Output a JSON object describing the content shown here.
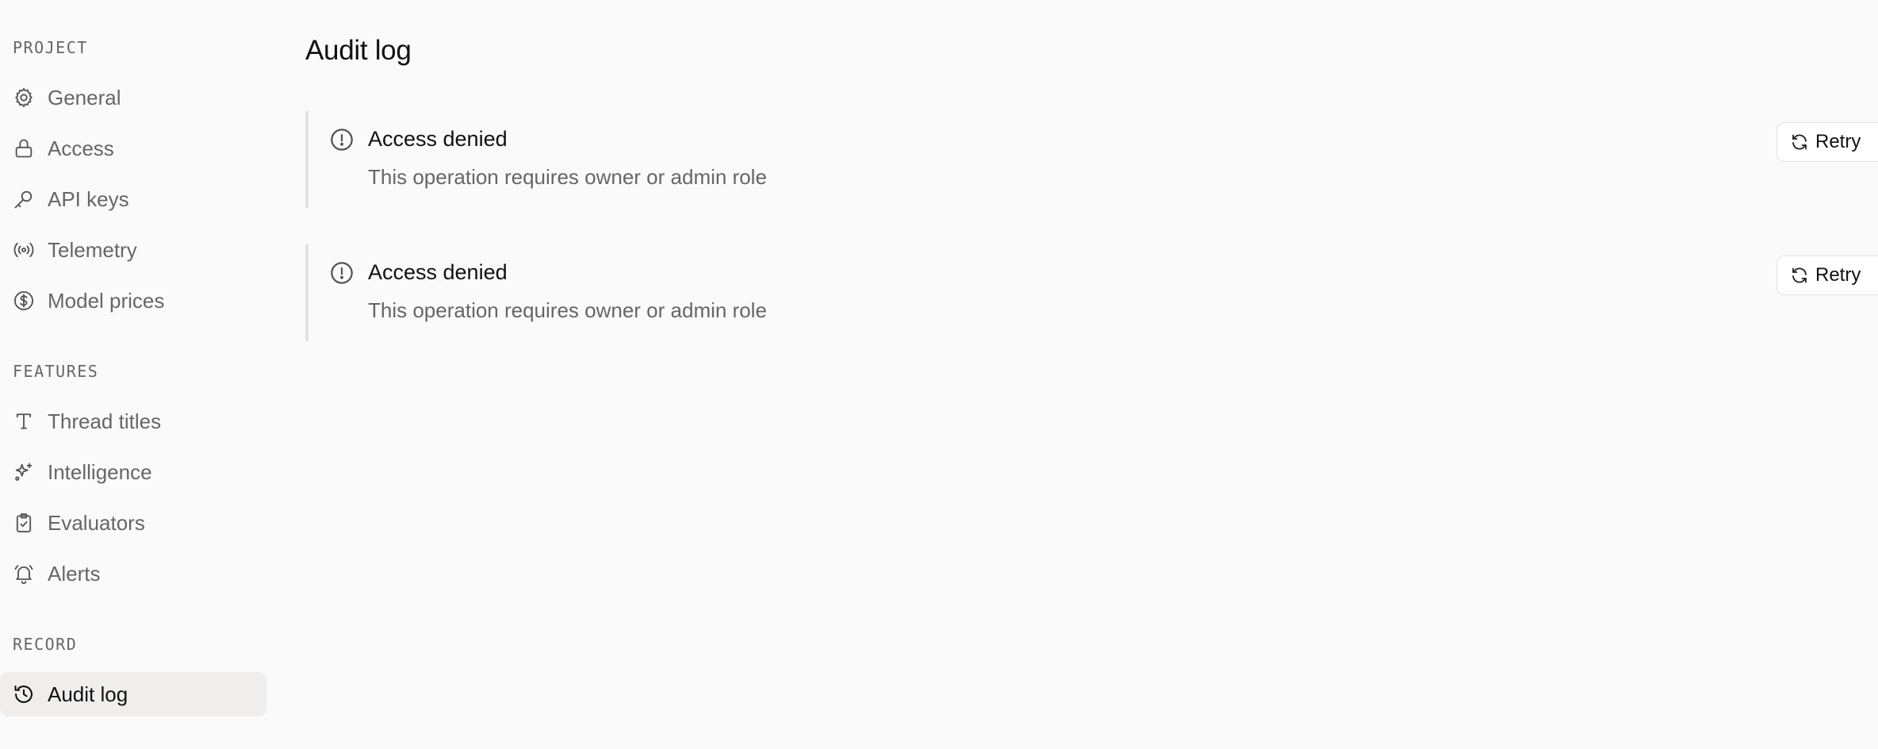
{
  "sidebar": {
    "sections": {
      "project": "PROJECT",
      "features": "FEATURES",
      "record": "RECORD"
    },
    "project_items": [
      {
        "label": "General",
        "icon": "gear-icon"
      },
      {
        "label": "Access",
        "icon": "lock-icon"
      },
      {
        "label": "API keys",
        "icon": "key-icon"
      },
      {
        "label": "Telemetry",
        "icon": "broadcast-icon"
      },
      {
        "label": "Model prices",
        "icon": "dollar-circle-icon"
      }
    ],
    "feature_items": [
      {
        "label": "Thread titles",
        "icon": "type-icon"
      },
      {
        "label": "Intelligence",
        "icon": "sparkles-icon"
      },
      {
        "label": "Evaluators",
        "icon": "clipboard-check-icon"
      },
      {
        "label": "Alerts",
        "icon": "bell-icon"
      }
    ],
    "record_items": [
      {
        "label": "Audit log",
        "icon": "history-icon",
        "active": true
      }
    ]
  },
  "main": {
    "title": "Audit log",
    "alerts": [
      {
        "title": "Access denied",
        "description": "This operation requires owner or admin role",
        "retry_label": "Retry",
        "icon": "alert-circle-icon"
      },
      {
        "title": "Access denied",
        "description": "This operation requires owner or admin role",
        "retry_label": "Retry",
        "icon": "alert-circle-icon"
      }
    ]
  },
  "colors": {
    "background": "#fafafa",
    "active_item_bg": "#efeeec",
    "muted_text": "#666666",
    "alert_border": "#e0e0e0"
  }
}
